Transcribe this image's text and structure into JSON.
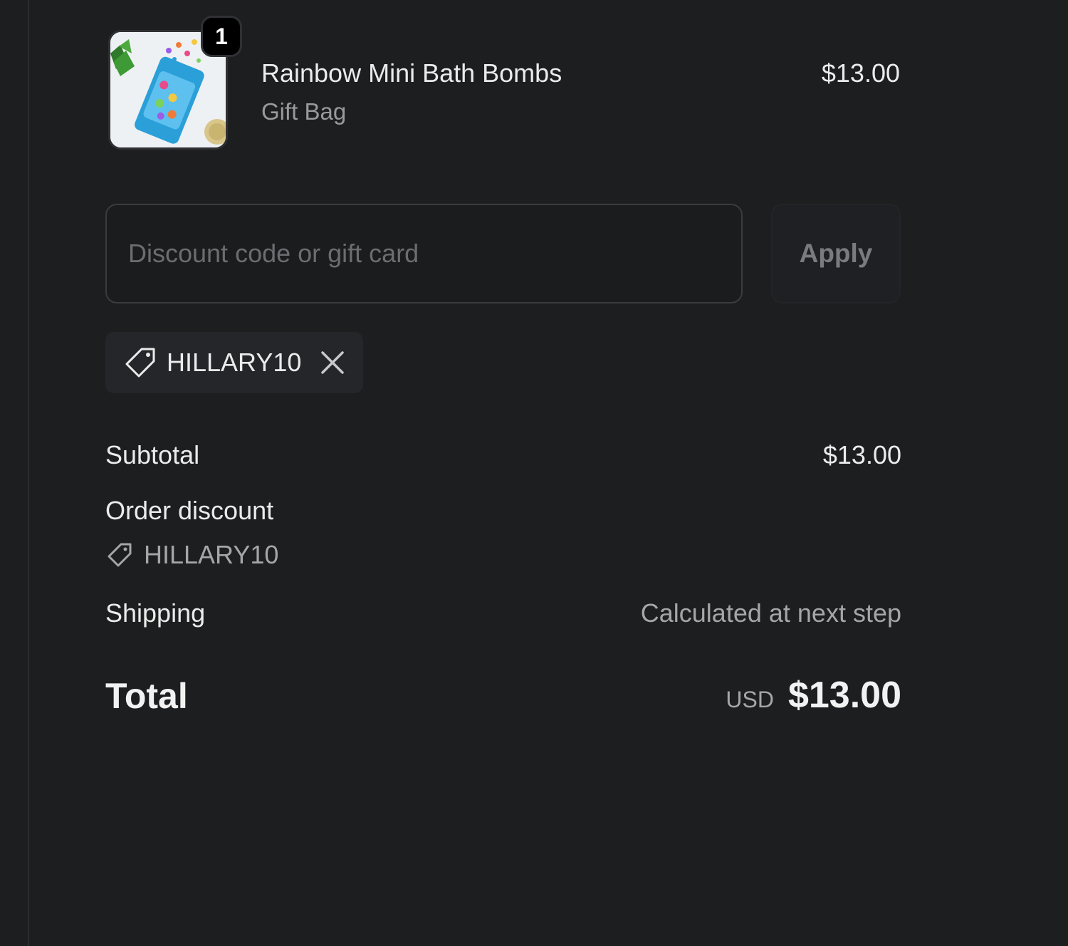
{
  "line_items": [
    {
      "name": "Rainbow Mini Bath Bombs",
      "variant": "Gift Bag",
      "price": "$13.00",
      "quantity": "1",
      "thumbnail_icon": "bath-bomb-bag-image"
    }
  ],
  "discount": {
    "placeholder": "Discount code or gift card",
    "value": "",
    "apply_label": "Apply",
    "applied_code": "HILLARY10"
  },
  "summary": {
    "subtotal_label": "Subtotal",
    "subtotal_value": "$13.00",
    "order_discount_label": "Order discount",
    "order_discount_code": "HILLARY10",
    "shipping_label": "Shipping",
    "shipping_value": "Calculated at next step",
    "total_label": "Total",
    "currency": "USD",
    "total_value": "$13.00"
  },
  "colors": {
    "background": "#1d1e20",
    "text": "#ebebeb",
    "muted": "#a6a6a8"
  }
}
